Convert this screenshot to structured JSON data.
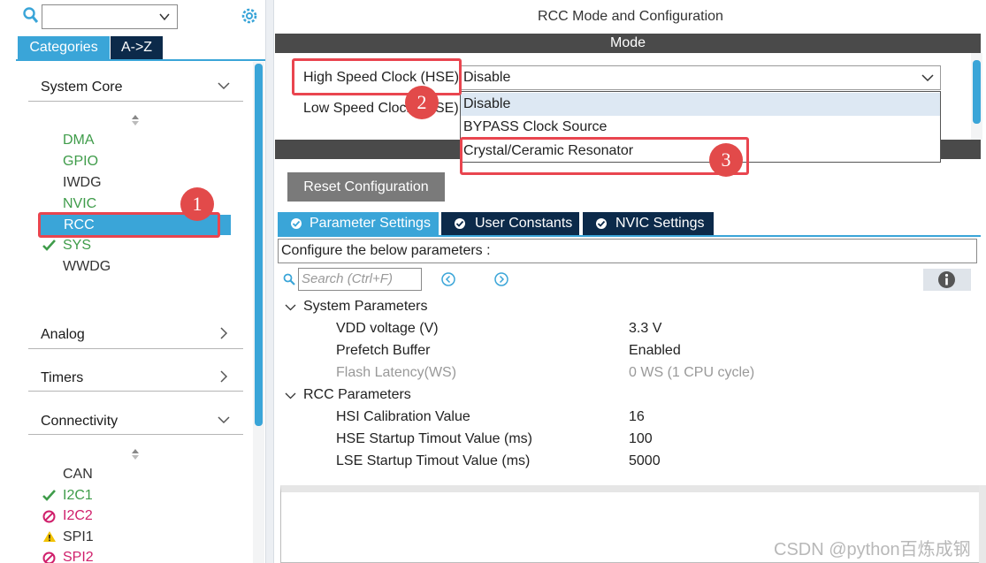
{
  "sidebar": {
    "search_value": "",
    "tabs": {
      "categories": "Categories",
      "az": "A->Z"
    },
    "sections": {
      "system_core": "System Core",
      "analog": "Analog",
      "timers": "Timers",
      "connectivity": "Connectivity"
    },
    "system_core_items": [
      {
        "label": "DMA",
        "status": "available"
      },
      {
        "label": "GPIO",
        "status": "available"
      },
      {
        "label": "IWDG",
        "status": "none"
      },
      {
        "label": "NVIC",
        "status": "available"
      },
      {
        "label": "RCC",
        "status": "selected"
      },
      {
        "label": "SYS",
        "status": "configured"
      },
      {
        "label": "WWDG",
        "status": "none"
      }
    ],
    "connectivity_items": [
      {
        "label": "CAN",
        "status": "none"
      },
      {
        "label": "I2C1",
        "status": "configured"
      },
      {
        "label": "I2C2",
        "status": "conflict"
      },
      {
        "label": "SPI1",
        "status": "warning"
      },
      {
        "label": "SPI2",
        "status": "conflict"
      }
    ]
  },
  "main": {
    "title": "RCC Mode and Configuration",
    "mode_header": "Mode",
    "hse_label": "High Speed Clock (HSE)",
    "hse_value": "Disable",
    "lse_label_left": "Low Speed Clock",
    "lse_label_right": "SE)",
    "dropdown_options": [
      "Disable",
      "BYPASS Clock Source",
      "Crystal/Ceramic Resonator"
    ],
    "reset_button": "Reset Configuration",
    "tabs": [
      "Parameter Settings",
      "User Constants",
      "NVIC Settings"
    ],
    "config_text": "Configure the below parameters :",
    "search_placeholder": "Search (Ctrl+F)",
    "groups": {
      "system": {
        "title": "System Parameters",
        "params": [
          {
            "name": "VDD voltage (V)",
            "value": "3.3 V",
            "disabled": false
          },
          {
            "name": "Prefetch Buffer",
            "value": "Enabled",
            "disabled": false
          },
          {
            "name": "Flash Latency(WS)",
            "value": "0 WS (1 CPU cycle)",
            "disabled": true
          }
        ]
      },
      "rcc": {
        "title": "RCC Parameters",
        "params": [
          {
            "name": "HSI Calibration Value",
            "value": "16",
            "disabled": false
          },
          {
            "name": "HSE Startup Timout Value (ms)",
            "value": "100",
            "disabled": false
          },
          {
            "name": "LSE Startup Timout Value (ms)",
            "value": "5000",
            "disabled": false
          }
        ]
      }
    }
  },
  "annotations": [
    "1",
    "2",
    "3"
  ],
  "watermark": "CSDN @python百炼成钢",
  "colors": {
    "accent": "#3aa5d8",
    "dark_navy": "#0c2a4a",
    "annotation": "#e24a4a",
    "green": "#3f9c4a",
    "pink": "#d0206c"
  }
}
